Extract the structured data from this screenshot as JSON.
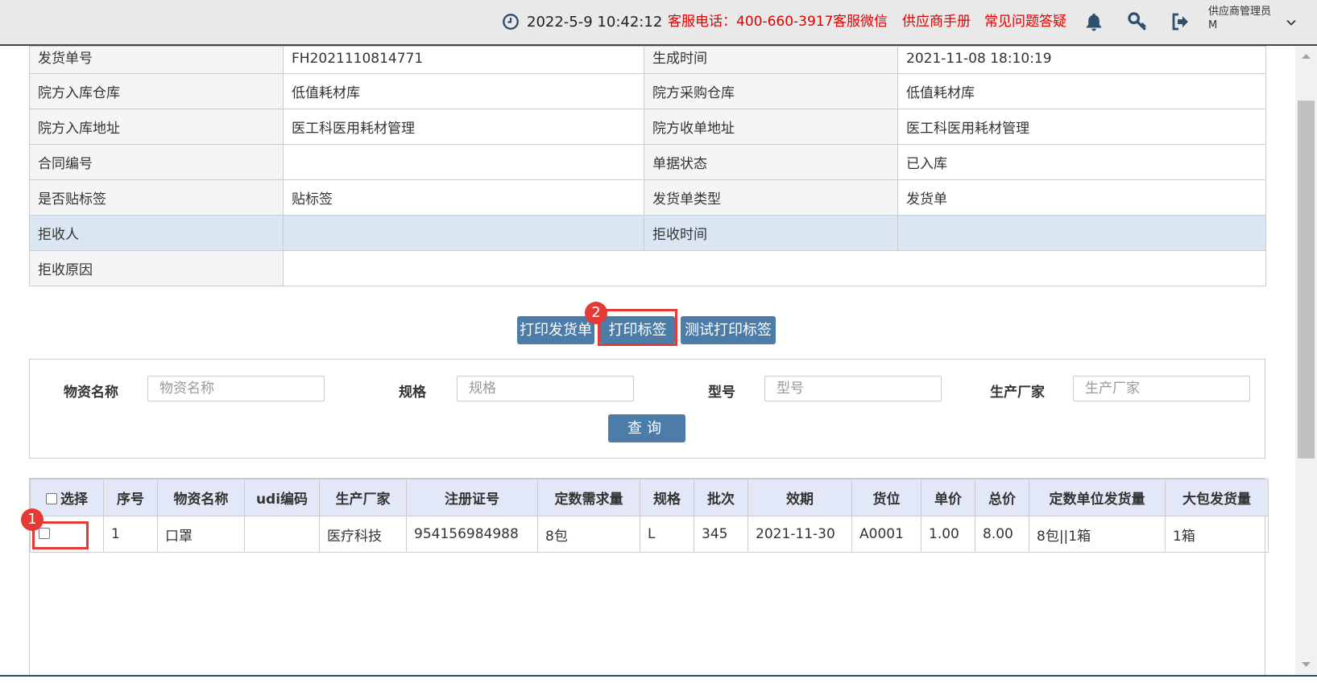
{
  "header": {
    "datetime": "2022-5-9  10:42:12",
    "hotline": "客服电话：400-660-3917",
    "wechat": "客服微信",
    "manual": "供应商手册",
    "faq": "常见问题答疑",
    "user_name": "供应商管理员",
    "user_sub": "M",
    "icons": [
      "clock-icon",
      "bell-icon",
      "key-icon",
      "logout-icon",
      "chevron-down-icon"
    ]
  },
  "info": {
    "rows": [
      {
        "l1": "发货单号",
        "v1": "FH2021110814771",
        "l2": "生成时间",
        "v2": "2021-11-08 18:10:19"
      },
      {
        "l1": "院方入库仓库",
        "v1": "低值耗材库",
        "l2": "院方采购仓库",
        "v2": "低值耗材库"
      },
      {
        "l1": "院方入库地址",
        "v1": "医工科医用耗材管理",
        "l2": "院方收单地址",
        "v2": "医工科医用耗材管理"
      },
      {
        "l1": "合同编号",
        "v1": "",
        "l2": "单据状态",
        "v2": "已入库"
      },
      {
        "l1": "是否贴标签",
        "v1": "贴标签",
        "l2": "发货单类型",
        "v2": "发货单"
      },
      {
        "l1": "拒收人",
        "v1": "",
        "l2": "拒收时间",
        "v2": ""
      }
    ],
    "reject_reason_label": "拒收原因",
    "reject_reason_value": ""
  },
  "actions": {
    "print_ship": "打印发货单",
    "print_label": "打印标签",
    "test_print_label": "测试打印标签"
  },
  "annotations": {
    "badge1": "1",
    "badge2": "2",
    "color": "#e53935"
  },
  "search": {
    "name_label": "物资名称",
    "name_placeholder": "物资名称",
    "spec_label": "规格",
    "spec_placeholder": "规格",
    "model_label": "型号",
    "model_placeholder": "型号",
    "mfr_label": "生产厂家",
    "mfr_placeholder": "生产厂家",
    "query": "查询"
  },
  "grid": {
    "headers": [
      "选择",
      "序号",
      "物资名称",
      "udi编码",
      "生产厂家",
      "注册证号",
      "定数需求量",
      "规格",
      "批次",
      "效期",
      "货位",
      "单价",
      "总价",
      "定数单位发货量",
      "大包发货量"
    ],
    "rows": [
      [
        "",
        "1",
        "口罩",
        "",
        "医疗科技",
        "954156984988",
        "8包",
        "L",
        "345",
        "2021-11-30",
        "A0001",
        "1.00",
        "8.00",
        "8包||1箱",
        "1箱"
      ]
    ]
  },
  "colors": {
    "primary": "#4c7ca8",
    "header_bg": "#e3e8f8",
    "highlight_row": "#dae6f1",
    "link_red": "#e00000"
  }
}
